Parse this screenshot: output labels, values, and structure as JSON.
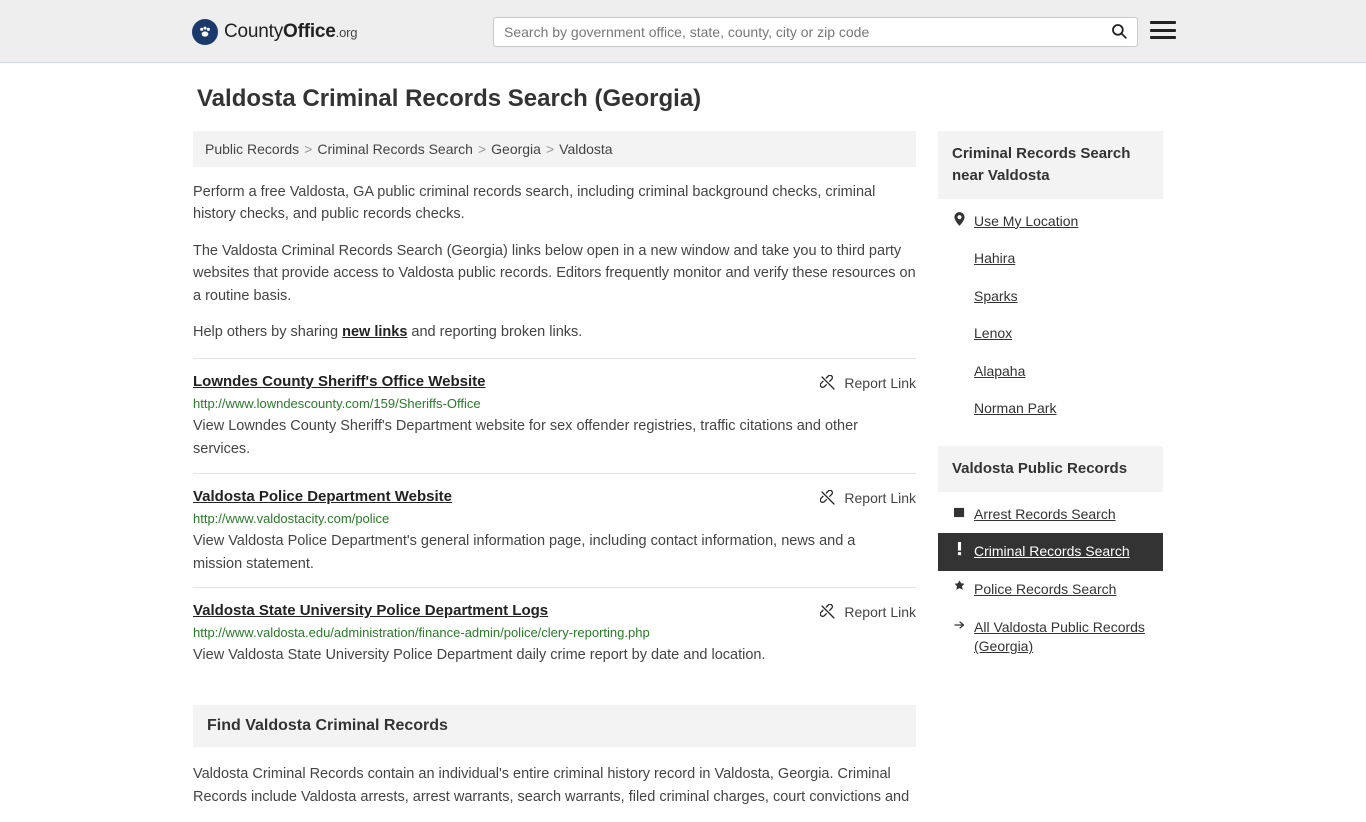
{
  "header": {
    "logo_text_part1": "County",
    "logo_text_part2": "Office",
    "logo_text_part3": ".org",
    "logo_icon": "paw-badge-icon",
    "search_placeholder": "Search by government office, state, county, city or zip code",
    "search_value": "",
    "search_icon": "search-icon",
    "menu_icon": "hamburger-menu-icon"
  },
  "page": {
    "title": "Valdosta Criminal Records Search (Georgia)"
  },
  "breadcrumb": [
    "Public Records",
    "Criminal Records Search",
    "Georgia",
    "Valdosta"
  ],
  "intro": {
    "p1": "Perform a free Valdosta, GA public criminal records search, including criminal background checks, criminal history checks, and public records checks.",
    "p2": "The Valdosta Criminal Records Search (Georgia) links below open in a new window and take you to third party websites that provide access to Valdosta public records. Editors frequently monitor and verify these resources on a routine basis.",
    "p3_before": "Help others by sharing ",
    "p3_link": "new links",
    "p3_after": " and reporting broken links."
  },
  "listings": [
    {
      "title": "Lowndes County Sheriff's Office Website",
      "url": "http://www.lowndescounty.com/159/Sheriffs-Office",
      "description": "View Lowndes County Sheriff's Department website for sex offender registries, traffic citations and other services.",
      "report_label": "Report Link",
      "report_icon": "broken-link-icon"
    },
    {
      "title": "Valdosta Police Department Website",
      "url": "http://www.valdostacity.com/police",
      "description": "View Valdosta Police Department's general information page, including contact information, news and a mission statement.",
      "report_label": "Report Link",
      "report_icon": "broken-link-icon"
    },
    {
      "title": "Valdosta State University Police Department Logs",
      "url": "http://www.valdosta.edu/administration/finance-admin/police/clery-reporting.php",
      "description": "View Valdosta State University Police Department daily crime report by date and location.",
      "report_label": "Report Link",
      "report_icon": "broken-link-icon"
    }
  ],
  "find_section": {
    "heading": "Find Valdosta Criminal Records",
    "body": "Valdosta Criminal Records contain an individual's entire criminal history record in Valdosta, Georgia. Criminal Records include Valdosta arrests, arrest warrants, search warrants, filed criminal charges, court convictions and"
  },
  "sidebar": {
    "near_card": {
      "heading": "Criminal Records Search near Valdosta",
      "items": [
        {
          "label": "Use My Location",
          "icon": "map-pin-icon",
          "active": false
        },
        {
          "label": "Hahira",
          "icon": "none",
          "active": false
        },
        {
          "label": "Sparks",
          "icon": "none",
          "active": false
        },
        {
          "label": "Lenox",
          "icon": "none",
          "active": false
        },
        {
          "label": "Alapaha",
          "icon": "none",
          "active": false
        },
        {
          "label": "Norman Park",
          "icon": "none",
          "active": false
        }
      ]
    },
    "public_records_card": {
      "heading": "Valdosta Public Records",
      "items": [
        {
          "label": "Arrest Records Search",
          "icon": "square-icon",
          "active": false
        },
        {
          "label": "Criminal Records Search",
          "icon": "exclamation-icon",
          "active": true
        },
        {
          "label": "Police Records Search",
          "icon": "badge-icon",
          "active": false
        },
        {
          "label": "All Valdosta Public Records (Georgia)",
          "icon": "arrow-right-icon",
          "active": false
        }
      ]
    }
  },
  "colors": {
    "header_bg": "#eeeeee",
    "accent_green": "#2a7a2a",
    "active_bg": "#333333",
    "panel_bg": "#f3f3f3"
  }
}
